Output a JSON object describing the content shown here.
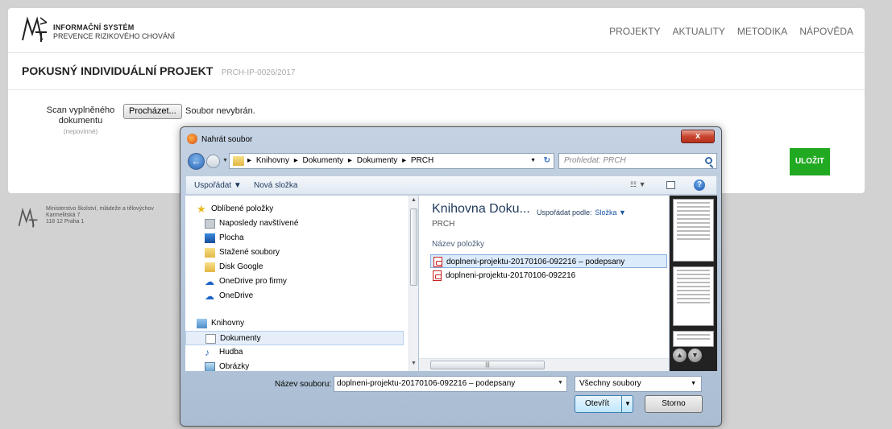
{
  "header": {
    "brand_line1": "INFORMAČNÍ SYSTÉM",
    "brand_line2": "PREVENCE RIZIKOVÉHO CHOVÁNÍ",
    "nav": [
      "PROJEKTY",
      "AKTUALITY",
      "METODIKA",
      "NÁPOVĚDA"
    ]
  },
  "project": {
    "title": "POKUSNÝ INDIVIDUÁLNÍ PROJEKT",
    "code": "PRCH-IP-0026/2017"
  },
  "form": {
    "scan_label": "Scan vyplněného dokumentu",
    "scan_optional": "(nepovinné)",
    "browse_button": "Procházet...",
    "browse_status": "Soubor nevybrán.",
    "save_button": "ULOŽIT"
  },
  "footer": {
    "line1": "Ministerstvo školství, mládeže a tělovýchov",
    "line2": "Karmelitská 7",
    "line3": "118 12 Praha 1"
  },
  "dialog": {
    "title": "Nahrát soubor",
    "close": "x",
    "breadcrumbs": [
      "Knihovny",
      "Dokumenty",
      "Dokumenty",
      "PRCH"
    ],
    "search_placeholder": "Prohledat: PRCH",
    "organize": "Uspořádat ▼",
    "new_folder": "Nová složka",
    "nav_tree": {
      "favorites": "Oblíbené položky",
      "recent": "Naposledy navštívené",
      "desktop": "Plocha",
      "downloads": "Stažené soubory",
      "google_drive": "Disk Google",
      "onedrive_business": "OneDrive pro firmy",
      "onedrive": "OneDrive",
      "libraries": "Knihovny",
      "documents": "Dokumenty",
      "music": "Hudba",
      "pictures": "Obrázky"
    },
    "library_title": "Knihovna Doku...",
    "library_sub": "PRCH",
    "arrange_label": "Uspořádat podle:",
    "arrange_value": "Složka ▼",
    "column_header": "Název položky",
    "files": [
      "doplneni-projektu-20170106-092216 – podepsany",
      "doplneni-projektu-20170106-092216"
    ],
    "filename_label": "Název souboru:",
    "filename_value": "doplneni-projektu-20170106-092216 – podepsany",
    "file_type": "Všechny soubory",
    "open_button": "Otevřít",
    "cancel_button": "Storno"
  }
}
